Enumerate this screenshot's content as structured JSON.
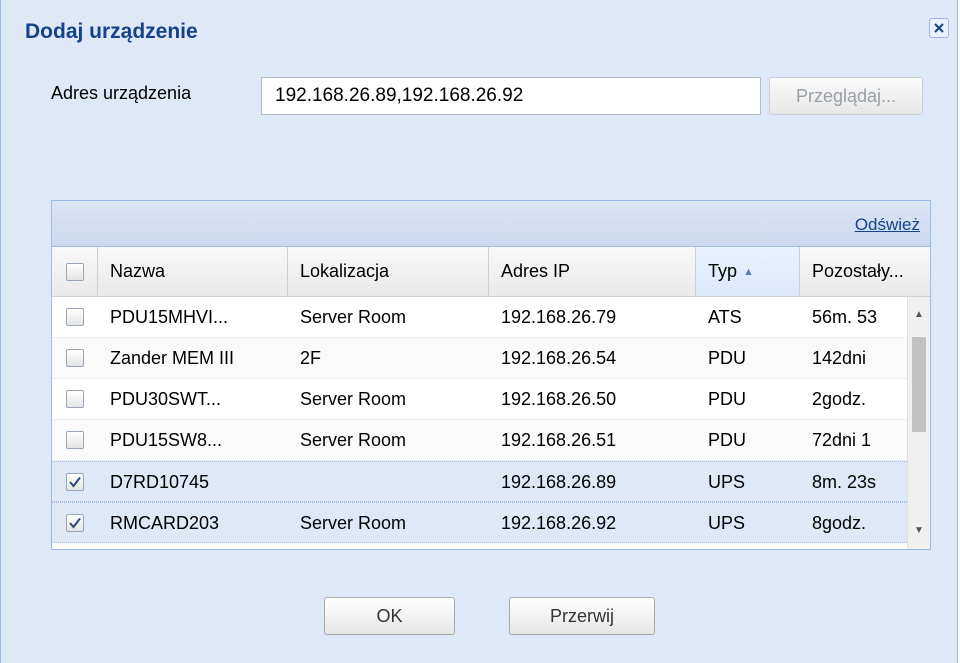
{
  "dialog": {
    "title": "Dodaj urządzenie",
    "address_label": "Adres urządzenia",
    "address_value": "192.168.26.89,192.168.26.92",
    "browse_label": "Przeglądaj..."
  },
  "grid": {
    "refresh_label": "Odśwież",
    "columns": [
      "Nazwa",
      "Lokalizacja",
      "Adres IP",
      "Typ",
      "Pozostały..."
    ],
    "sorted_column": "Typ",
    "sort_direction": "ascending",
    "rows": [
      {
        "checked": false,
        "name": "PDU15MHVI...",
        "location": "Server Room",
        "ip": "192.168.26.79",
        "type": "ATS",
        "remaining": "56m. 53"
      },
      {
        "checked": false,
        "name": "Zander MEM III",
        "location": "2F",
        "ip": "192.168.26.54",
        "type": "PDU",
        "remaining": "142dni"
      },
      {
        "checked": false,
        "name": "PDU30SWT...",
        "location": "Server Room",
        "ip": "192.168.26.50",
        "type": "PDU",
        "remaining": "2godz."
      },
      {
        "checked": false,
        "name": "PDU15SW8...",
        "location": "Server Room",
        "ip": "192.168.26.51",
        "type": "PDU",
        "remaining": "72dni 1"
      },
      {
        "checked": true,
        "name": "D7RD10745",
        "location": "",
        "ip": "192.168.26.89",
        "type": "UPS",
        "remaining": "8m. 23s"
      },
      {
        "checked": true,
        "name": "RMCARD203",
        "location": "Server Room",
        "ip": "192.168.26.92",
        "type": "UPS",
        "remaining": "8godz."
      }
    ]
  },
  "buttons": {
    "ok": "OK",
    "cancel": "Przerwij"
  },
  "icons": {
    "close": "close-icon",
    "sort": "sort-ascending-icon",
    "checkbox": "checkbox-icon",
    "scroll_up": "scroll-up-icon",
    "scroll_down": "scroll-down-icon"
  },
  "colors": {
    "title": "#15428b",
    "dialog_bg": "#dfe8f6",
    "border": "#99bbe8",
    "selected_row": "#dfe8f6"
  }
}
